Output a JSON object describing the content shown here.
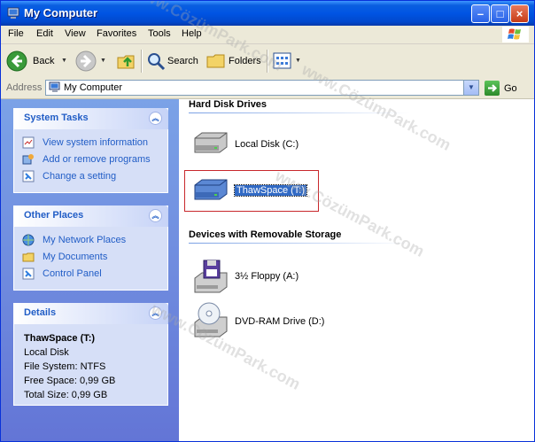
{
  "window": {
    "title": "My Computer",
    "controls": {
      "minimize": "–",
      "maximize": "□",
      "close": "×"
    }
  },
  "menu": [
    "File",
    "Edit",
    "View",
    "Favorites",
    "Tools",
    "Help"
  ],
  "toolbar": {
    "back_label": "Back",
    "search_label": "Search",
    "folders_label": "Folders"
  },
  "address": {
    "label": "Address",
    "value": "My Computer",
    "go_label": "Go"
  },
  "sidebar": {
    "system_tasks": {
      "title": "System Tasks",
      "items": [
        {
          "label": "View system information",
          "icon": "system-info-icon"
        },
        {
          "label": "Add or remove programs",
          "icon": "add-remove-programs-icon"
        },
        {
          "label": "Change a setting",
          "icon": "control-panel-icon"
        }
      ]
    },
    "other_places": {
      "title": "Other Places",
      "items": [
        {
          "label": "My Network Places",
          "icon": "network-places-icon"
        },
        {
          "label": "My Documents",
          "icon": "folder-icon"
        },
        {
          "label": "Control Panel",
          "icon": "control-panel-icon"
        }
      ]
    },
    "details": {
      "title": "Details",
      "name": "ThawSpace (T:)",
      "type": "Local Disk",
      "file_system": "File System: NTFS",
      "free_space": "Free Space: 0,99 GB",
      "total_size": "Total Size: 0,99 GB"
    }
  },
  "content": {
    "hard_disks": {
      "title": "Hard Disk Drives",
      "items": [
        {
          "label": "Local Disk (C:)",
          "icon": "hard-disk-icon"
        },
        {
          "label": "ThawSpace (T:)",
          "icon": "hard-disk-blue-icon",
          "selected": true
        }
      ]
    },
    "removable": {
      "title": "Devices with Removable Storage",
      "items": [
        {
          "label": "3½ Floppy (A:)",
          "icon": "floppy-drive-icon"
        },
        {
          "label": "DVD-RAM Drive (D:)",
          "icon": "dvd-drive-icon"
        }
      ]
    }
  },
  "watermark": "www.CözümPark.com",
  "colors": {
    "titlebar": "#0054e3",
    "sidebar_bg": "#6f8fdc",
    "panel_bg": "#d6dff7",
    "link": "#215dc6",
    "selection": "#316ac5",
    "highlight_box": "#c8282c"
  }
}
